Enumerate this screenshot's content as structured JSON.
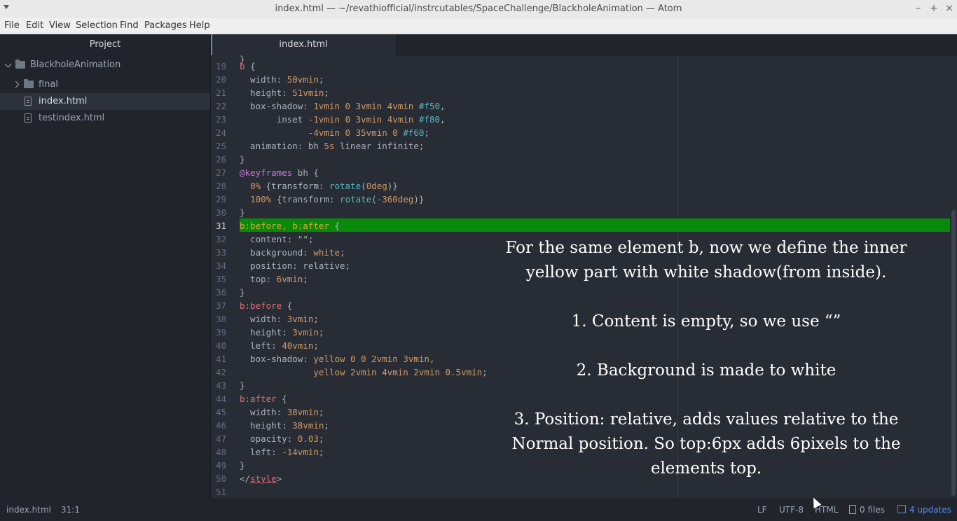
{
  "window": {
    "title": "index.html — ~/revathiofficial/instrcutables/SpaceChallenge/BlackholeAnimation — Atom",
    "minimize": "–",
    "maximize": "+",
    "close": "×"
  },
  "menu": [
    "File",
    "Edit",
    "View",
    "Selection",
    "Find",
    "Packages",
    "Help"
  ],
  "sidebar": {
    "header": "Project",
    "root": "BlackholeAnimation",
    "items": [
      {
        "label": "final",
        "type": "folder"
      },
      {
        "label": "index.html",
        "type": "file",
        "selected": true
      },
      {
        "label": "testindex.html",
        "type": "file"
      }
    ]
  },
  "tab": {
    "label": "index.html"
  },
  "editor": {
    "line_numbers": [
      "19",
      "20",
      "21",
      "22",
      "23",
      "24",
      "25",
      "26",
      "27",
      "28",
      "29",
      "30",
      "31",
      "32",
      "33",
      "34",
      "35",
      "36",
      "37",
      "38",
      "39",
      "40",
      "41",
      "42",
      "43",
      "44",
      "45",
      "46",
      "47",
      "48",
      "49",
      "50",
      "51"
    ],
    "active_line": "31",
    "highlight_color": "#0a8a0a"
  },
  "caption": {
    "p1": "For the same element b, now we define the inner yellow part with white shadow(from inside).",
    "p2": "1. Content is empty, so we use “”",
    "p3": "2. Background is made to white",
    "p4": "3. Position: relative, adds values relative to the Normal position. So top:6px adds 6pixels to the elements top."
  },
  "status": {
    "file": "index.html",
    "cursor": "31:1",
    "line_ending": "LF",
    "encoding": "UTF-8",
    "grammar": "HTML",
    "files": "0 files",
    "updates": "4 updates"
  }
}
